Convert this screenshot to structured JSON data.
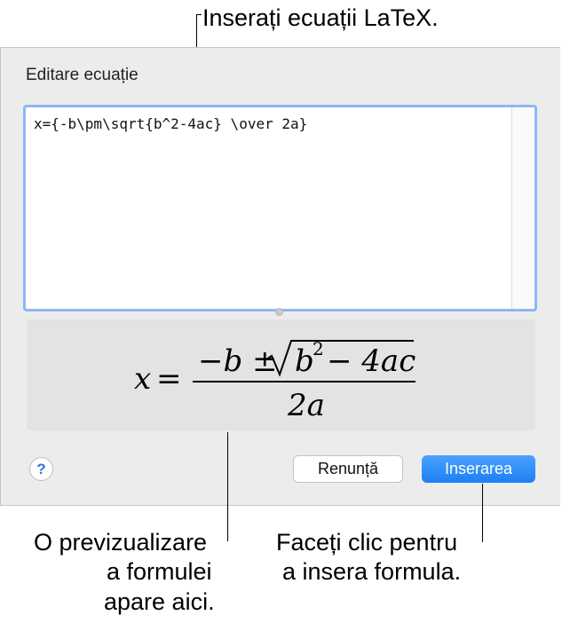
{
  "callouts": {
    "top": "Inserați ecuații LaTeX.",
    "preview_line1": "O previzualizare",
    "preview_line2": "a formulei",
    "preview_line3": "apare aici.",
    "insert_line1": "Faceți clic pentru",
    "insert_line2": "a insera formula."
  },
  "dialog": {
    "title": "Editare ecuație",
    "latex_value": "x={-b\\pm\\sqrt{b^2-4ac} \\over 2a}",
    "preview": {
      "lhs": "x",
      "equals": "=",
      "numerator": "−b ±",
      "radicand": "b",
      "exponent": "2",
      "radicand_rest": "− 4ac",
      "denominator": "2a"
    },
    "help_label": "?",
    "cancel_label": "Renunță",
    "insert_label": "Inserarea"
  },
  "colors": {
    "accent": "#1f7ff2",
    "focus_ring": "#8cb8f2",
    "dialog_bg": "#ececec",
    "preview_bg": "#e3e3e3"
  }
}
